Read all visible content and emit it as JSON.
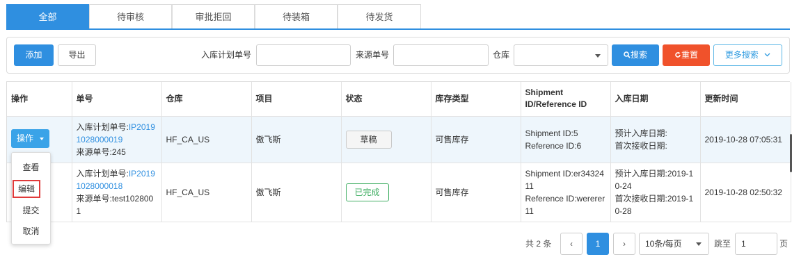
{
  "tabs": [
    "全部",
    "待审核",
    "审批拒回",
    "待装箱",
    "待发货"
  ],
  "toolbar": {
    "add_label": "添加",
    "export_label": "导出",
    "plan_no_label": "入库计划单号",
    "source_no_label": "来源单号",
    "warehouse_label": "仓库",
    "search_label": "搜索",
    "reset_label": "重置",
    "more_search_label": "更多搜索"
  },
  "table": {
    "headers": [
      "操作",
      "单号",
      "仓库",
      "项目",
      "状态",
      "库存类型",
      "Shipment ID/Reference ID",
      "入库日期",
      "更新时间"
    ],
    "header_shipment_line1": "Shipment",
    "header_shipment_line2": "ID/Reference ID",
    "rows": [
      {
        "plan_prefix": "入库计划单号:",
        "plan_no_a": "IP2019",
        "plan_no_b": "1028000019",
        "source": "来源单号:245",
        "warehouse": "HF_CA_US",
        "project": "傲飞斯",
        "status": "草稿",
        "stock_type": "可售库存",
        "shipment": "Shipment ID:5",
        "reference": "Reference ID:6",
        "date1": "预计入库日期:",
        "date2": "首次接收日期:",
        "updated": "2019-10-28 07:05:31"
      },
      {
        "plan_prefix": "入库计划单号:",
        "plan_no_a": "IP2019",
        "plan_no_b": "1028000018",
        "source_a": "来源单号:test102800",
        "source_b": "1",
        "warehouse": "HF_CA_US",
        "project": "傲飞斯",
        "status": "已完成",
        "stock_type": "可售库存",
        "shipment_a": "Shipment ID:er34324",
        "shipment_b": "11",
        "reference_a": "Reference ID:wererer",
        "reference_b": "11",
        "date1_a": "预计入库日期:2019-1",
        "date1_b": "0-24",
        "date2_a": "首次接收日期:2019-1",
        "date2_b": "0-28",
        "updated": "2019-10-28 02:50:32"
      }
    ]
  },
  "actions": {
    "button_label": "操作",
    "menu": [
      "查看",
      "编辑",
      "提交",
      "取消"
    ]
  },
  "pagination": {
    "total": "共 2 条",
    "prev": "‹",
    "current": "1",
    "next": "›",
    "page_size": "10条/每页",
    "jump_label": "跳至",
    "jump_value": "1",
    "page_suffix": "页"
  },
  "colors": {
    "primary": "#2f8fe0",
    "danger": "#f0522b",
    "success": "#3fae62"
  }
}
